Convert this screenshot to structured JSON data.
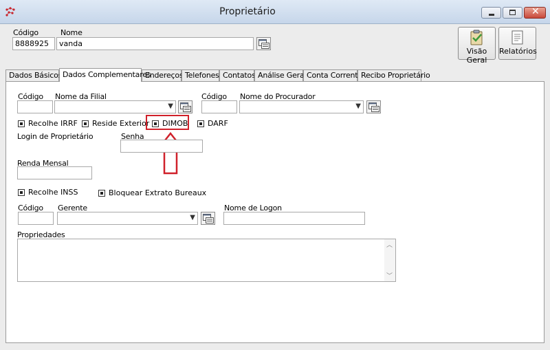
{
  "window": {
    "title": "Proprietário"
  },
  "header": {
    "codigo_label": "Código",
    "codigo_value": "8888925",
    "nome_label": "Nome",
    "nome_value": "vanda",
    "visao_geral_label": "Visão Geral",
    "relatorios_label": "Relatórios"
  },
  "tabs": [
    {
      "label": "Dados Básicos"
    },
    {
      "label": "Dados Complementares",
      "active": true
    },
    {
      "label": "Endereços"
    },
    {
      "label": "Telefones"
    },
    {
      "label": "Contatos"
    },
    {
      "label": "Análise Geral"
    },
    {
      "label": "Conta Corrente"
    },
    {
      "label": "Recibo Proprietário"
    }
  ],
  "form": {
    "filial": {
      "codigo_label": "Código",
      "nome_label": "Nome da Filial"
    },
    "procurador": {
      "codigo_label": "Código",
      "nome_label": "Nome do Procurador"
    },
    "checkboxes": {
      "recolhe_irrf": "Recolhe IRRF",
      "reside_exterior": "Reside Exterior",
      "dimob": "DIMOB",
      "darf": "DARF",
      "recolhe_inss": "Recolhe INSS",
      "bloquear_extrato": "Bloquear Extrato Bureaux"
    },
    "login_label": "Login de Proprietário",
    "senha_label": "Senha",
    "renda_label": "Renda Mensal",
    "gerente": {
      "codigo_label": "Código",
      "nome_label": "Gerente"
    },
    "logon_label": "Nome de Logon",
    "propriedades_label": "Propriedades"
  },
  "annotation": {
    "highlight_color": "#d0202a"
  }
}
